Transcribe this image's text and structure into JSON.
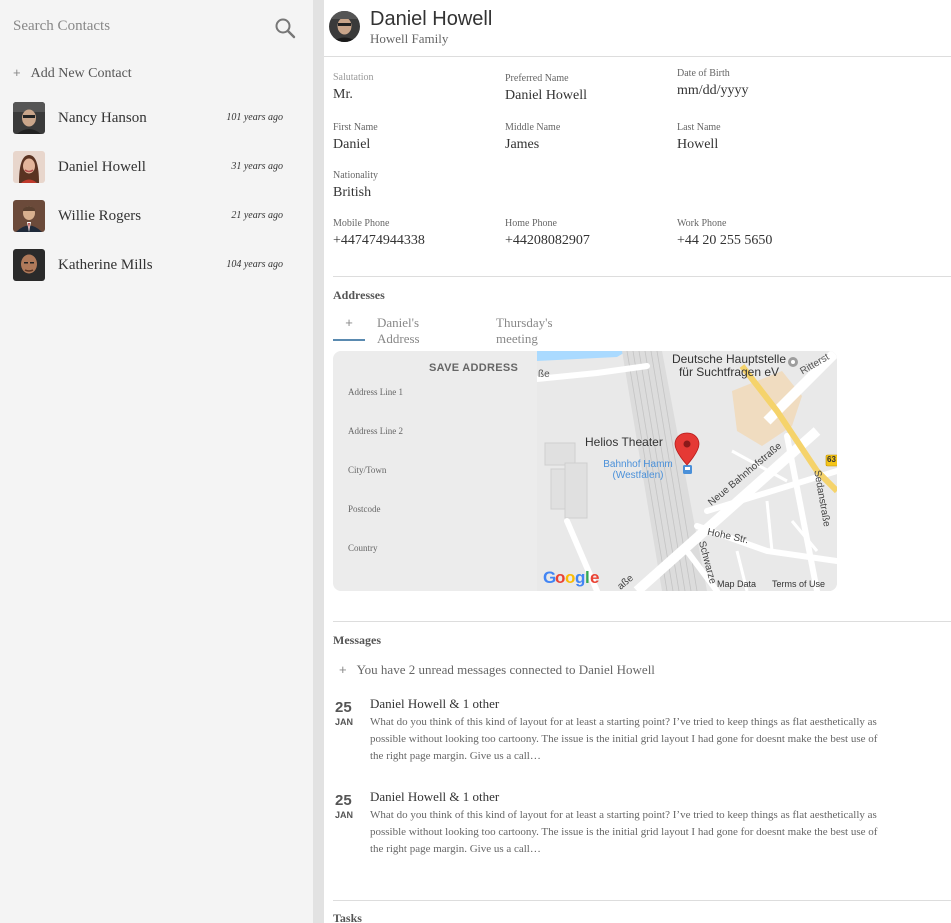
{
  "sidebar": {
    "search_placeholder": "Search Contacts",
    "add_contact_label": "Add New Contact",
    "contacts": [
      {
        "name": "Nancy Hanson",
        "ago": "101 years ago"
      },
      {
        "name": "Daniel Howell",
        "ago": "31 years ago"
      },
      {
        "name": "Willie Rogers",
        "ago": "21 years ago"
      },
      {
        "name": "Katherine Mills",
        "ago": "104 years ago"
      }
    ]
  },
  "header": {
    "name": "Daniel Howell",
    "family": "Howell Family"
  },
  "details": {
    "salutation": {
      "label": "Salutation",
      "value": "Mr."
    },
    "preferred_name": {
      "label": "Preferred Name",
      "value": "Daniel Howell"
    },
    "date_of_birth": {
      "label": "Date of Birth",
      "placeholder": "mm/dd/yyyy"
    },
    "first_name": {
      "label": "First Name",
      "value": "Daniel"
    },
    "middle_name": {
      "label": "Middle Name",
      "value": "James"
    },
    "last_name": {
      "label": "Last Name",
      "value": "Howell"
    },
    "nationality": {
      "label": "Nationality",
      "value": "British"
    },
    "mobile_phone": {
      "label": "Mobile Phone",
      "value": "+447474944338"
    },
    "home_phone": {
      "label": "Home Phone",
      "value": "+44208082907"
    },
    "work_phone": {
      "label": "Work Phone",
      "value": "+44 20 255 5650"
    }
  },
  "addresses": {
    "title": "Addresses",
    "tabs": [
      "+",
      "Daniel's Address",
      "Thursday's meeting"
    ],
    "save_label": "SAVE ADDRESS",
    "fields": [
      "Address Line 1",
      "Address Line 2",
      "City/Town",
      "Postcode",
      "Country"
    ],
    "map": {
      "labels": {
        "institution": "Deutsche Hauptstelle\nfür Suchtfragen eV",
        "theater": "Helios Theater",
        "station": "Bahnhof Hamm\n(Westfalen)",
        "street1": "Neue Bahnhofstraße",
        "street2": "Hohe Str.",
        "street3": "Sedanstraße",
        "street4": "Schwarze",
        "street5": "Ritterst",
        "road_badge": "63",
        "street_left": "ße",
        "street_bottom": "aße",
        "google": "Google",
        "map_data": "Map Data",
        "terms": "Terms of Use"
      }
    }
  },
  "messages": {
    "title": "Messages",
    "unread_text": "You have 2 unread messages connected to Daniel Howell",
    "items": [
      {
        "day": "25",
        "month": "JAN",
        "from": "Daniel Howell & 1 other",
        "body": "What do you think of this kind of layout for at least a starting point? I’ve tried to keep things as flat aesthetically as possible without looking too cartoony. The issue is the initial grid layout I had gone for doesnt make the best use of the right page margin. Give us a call…"
      },
      {
        "day": "25",
        "month": "JAN",
        "from": "Daniel Howell & 1 other",
        "body": "What do you think of this kind of layout for at least a starting point? I’ve tried to keep things as flat aesthetically as possible without looking too cartoony. The issue is the initial grid layout I had gone for doesnt make the best use of the right page margin. Give us a call…"
      }
    ]
  },
  "tasks": {
    "title": "Tasks"
  },
  "colors": {
    "accent": "#5a8ab0",
    "pin": "#e53935",
    "sidebar_bg": "#f4f4f4"
  }
}
